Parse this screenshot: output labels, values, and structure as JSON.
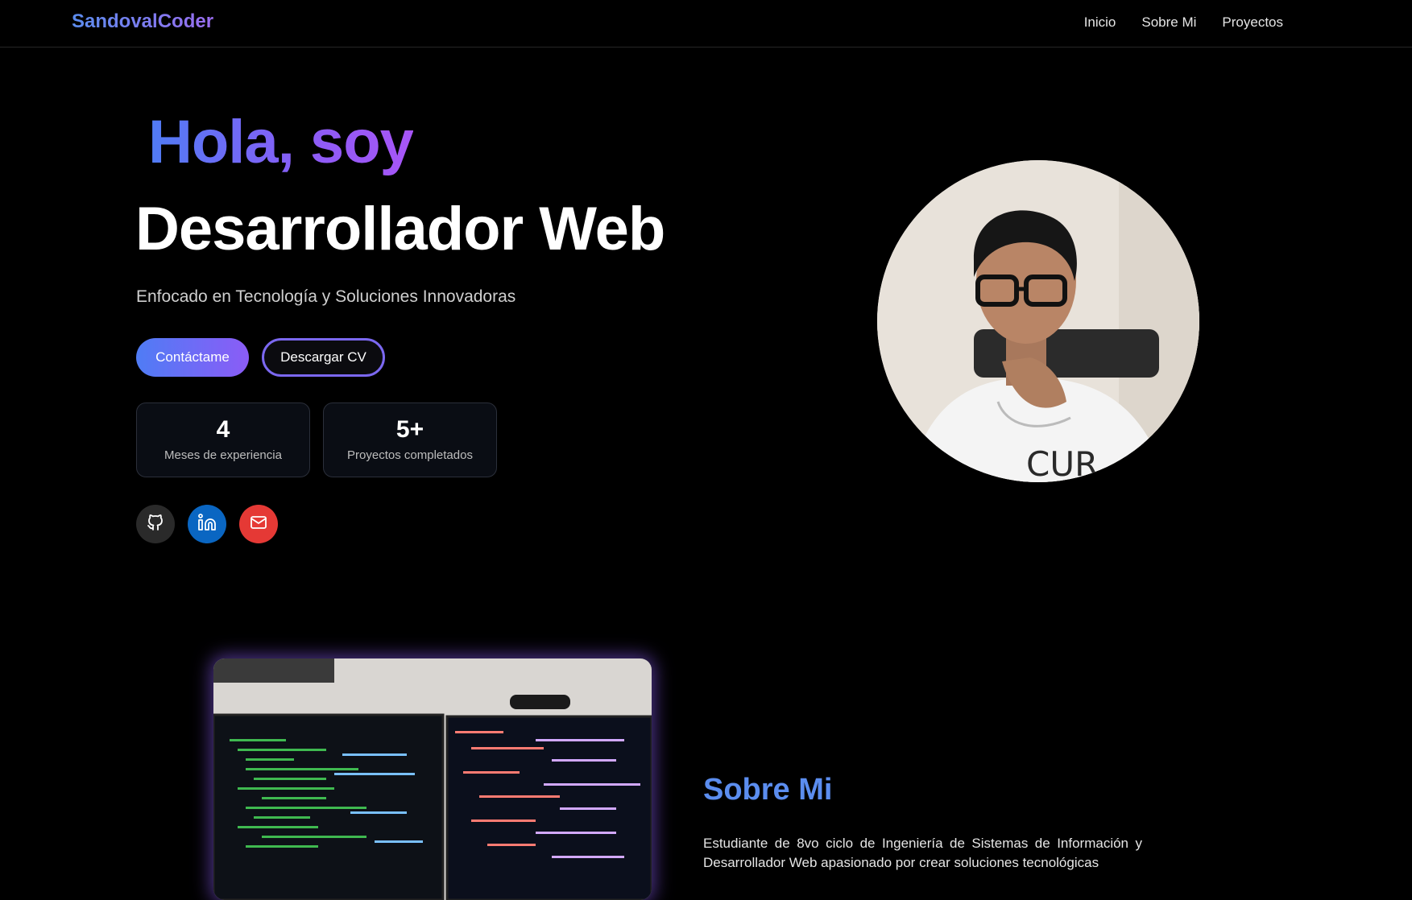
{
  "nav": {
    "brand": "SandovalCoder",
    "links": [
      "Inicio",
      "Sobre Mi",
      "Proyectos"
    ]
  },
  "hero": {
    "greeting": "Hola, soy",
    "role": "Desarrollador Web",
    "tagline": "Enfocado en Tecnología y Soluciones Innovadoras",
    "contact_button": "Contáctame",
    "cv_button": "Descargar CV",
    "stats": [
      {
        "value": "4",
        "label": "Meses de experiencia"
      },
      {
        "value": "5+",
        "label": "Proyectos completados"
      }
    ],
    "socials": [
      {
        "name": "github-icon",
        "color": "#2a2a2a"
      },
      {
        "name": "linkedin-icon",
        "color": "#0a66c2"
      },
      {
        "name": "mail-icon",
        "color": "#e53935"
      }
    ]
  },
  "about": {
    "title": "Sobre Mi",
    "text": "Estudiante de 8vo ciclo de Ingeniería de Sistemas de Información y Desarrollador Web apasionado por crear soluciones tecnológicas"
  },
  "colors": {
    "accent_blue": "#5b8def",
    "accent_purple": "#8b5cf6",
    "background": "#000000"
  }
}
